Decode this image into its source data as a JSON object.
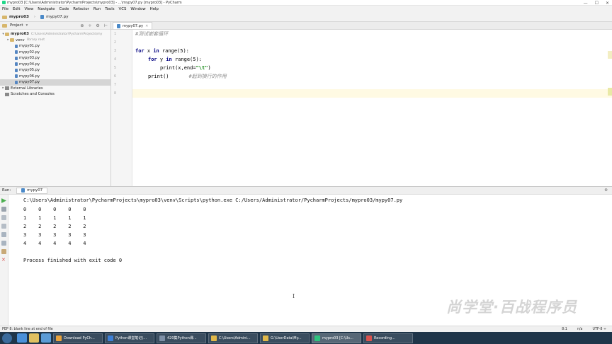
{
  "window": {
    "title": "mypro03 [C:\\Users\\Administrator\\PycharmProjects\\mypro03] - ...\\mypy07.py [mypro03] - PyCharm",
    "controls": [
      "—",
      "☐",
      "✕"
    ]
  },
  "menu": [
    "File",
    "Edit",
    "View",
    "Navigate",
    "Code",
    "Refactor",
    "Run",
    "Tools",
    "VCS",
    "Window",
    "Help"
  ],
  "navbar": {
    "project": "mypro03",
    "file": "mypy07.py"
  },
  "project_panel": {
    "title": "Project",
    "tools": [
      "⊕",
      "÷",
      "⚙",
      "⊢"
    ],
    "tree": [
      {
        "name": "mypro03",
        "hint": "C:\\Users\\Administrator\\PycharmProjects\\my",
        "type": "folder",
        "arrow": "▾",
        "indent": 0,
        "bold": true
      },
      {
        "name": "venv",
        "hint": "library root",
        "type": "folder",
        "arrow": "▸",
        "indent": 1
      },
      {
        "name": "mypy01.py",
        "type": "file",
        "indent": 2
      },
      {
        "name": "mypy02.py",
        "type": "file",
        "indent": 2
      },
      {
        "name": "mypy03.py",
        "type": "file",
        "indent": 2
      },
      {
        "name": "mypy04.py",
        "type": "file",
        "indent": 2
      },
      {
        "name": "mypy05.py",
        "type": "file",
        "indent": 2
      },
      {
        "name": "mypy06.py",
        "type": "file",
        "indent": 2
      },
      {
        "name": "mypy07.py",
        "type": "file",
        "indent": 2,
        "selected": true
      },
      {
        "name": "External Libraries",
        "type": "lib",
        "arrow": "▸",
        "indent": 0
      },
      {
        "name": "Scratches and Consoles",
        "type": "lib",
        "indent": 0
      }
    ]
  },
  "editor": {
    "tab_label": "mypy07.py",
    "line_numbers": [
      "1",
      "2",
      "3",
      "4",
      "5",
      "6",
      "7",
      "8"
    ],
    "code": {
      "l1_comment": "#测试嵌套循环",
      "l3_for": "for",
      "l3_rest": " x ",
      "l3_in": "in",
      "l3_tail": " range(5):",
      "l4_for": "for",
      "l4_rest": " y ",
      "l4_in": "in",
      "l4_tail": " range(5):",
      "l5_a": "print(x,end=",
      "l5_str": "\"\\t\"",
      "l5_b": ")",
      "l6_code": "print()",
      "l6_comment": "#起到换行的作用"
    }
  },
  "run_panel": {
    "label": "Run:",
    "tab": "mypy07",
    "command": "C:\\Users\\Administrator\\PycharmProjects\\mypro03\\venv\\Scripts\\python.exe C:/Users/Administrator/PycharmProjects/mypro03/mypy07.py",
    "output_rows": [
      "0    0    0    0    0",
      "1    1    1    1    1",
      "2    2    2    2    2",
      "3    3    3    3    3",
      "4    4    4    4    4"
    ],
    "exit_message": "Process finished with exit code 0",
    "cursor_glyph": "I"
  },
  "watermark": "尚学堂·百战程序员",
  "statusbar": {
    "message": "PEP 8: blank line at end of file",
    "position": "8:1",
    "line_sep": "n/a",
    "encoding": "UTF-8 ÷"
  },
  "taskbar": {
    "tasks": [
      {
        "label": "Download PyCh...",
        "color": "#e8a33d"
      },
      {
        "label": "Python课堂笔记(...",
        "color": "#3d7fd6"
      },
      {
        "label": "420集Python课...",
        "color": "#7d8fa6"
      },
      {
        "label": "C:\\Users\\Admini...",
        "color": "#e0b84a"
      },
      {
        "label": "G:\\UserData\\My...",
        "color": "#e0b84a"
      },
      {
        "label": "mypro03 [C:\\Us...",
        "color": "#2ec27e"
      },
      {
        "label": "Recording...",
        "color": "#d9534f"
      }
    ]
  },
  "colors": {
    "keyword": "#000080",
    "string": "#008000",
    "comment": "#8c8c8c",
    "taskbar": "#1f3549"
  }
}
